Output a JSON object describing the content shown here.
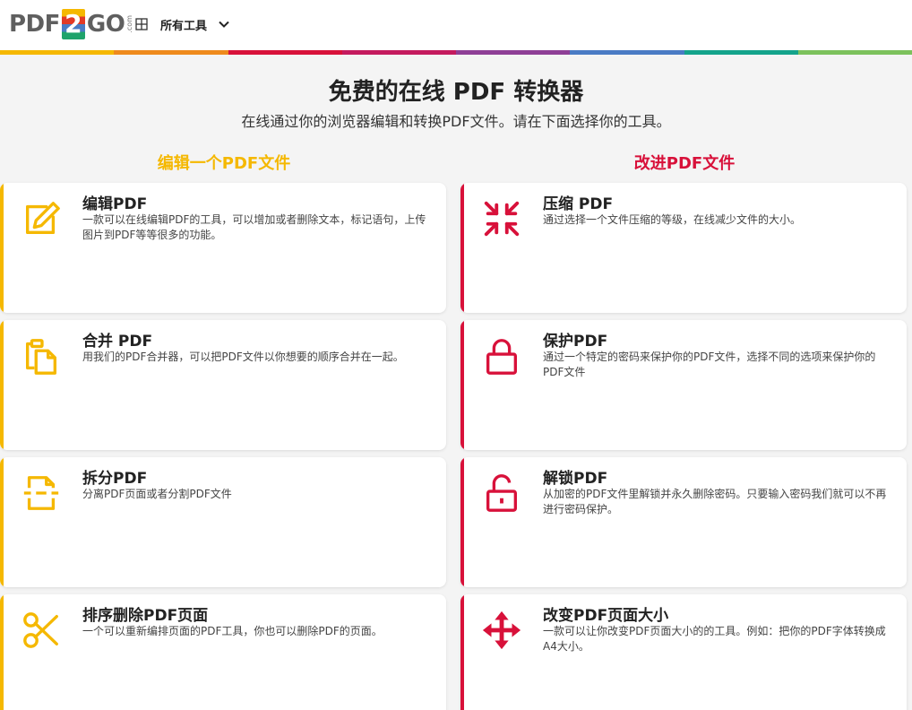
{
  "header": {
    "logo": {
      "pdf": "PDF",
      "two": "2",
      "go": "GO",
      "com": ".com"
    },
    "tools_menu_label": "所有工具"
  },
  "colors": {
    "yellow": "#f5b800",
    "red": "#d8113a",
    "stripe": [
      "#f5b800",
      "#ee8a1c",
      "#d8113a",
      "#c41a5e",
      "#8e3f96",
      "#4a7bc4",
      "#14a38b",
      "#7cc15c"
    ]
  },
  "hero": {
    "title": "免费的在线 PDF 转换器",
    "subtitle": "在线通过你的浏览器编辑和转换PDF文件。请在下面选择你的工具。"
  },
  "columns": {
    "left": {
      "heading": "编辑一个PDF文件",
      "cards": [
        {
          "icon": "edit-icon",
          "title": "编辑PDF",
          "desc": "一款可以在线编辑PDF的工具，可以增加或者删除文本，标记语句，上传图片到PDF等等很多的功能。"
        },
        {
          "icon": "merge-icon",
          "title": "合并 PDF",
          "desc": "用我们的PDF合并器，可以把PDF文件以你想要的顺序合并在一起。"
        },
        {
          "icon": "split-icon",
          "title": "拆分PDF",
          "desc": "分离PDF页面或者分割PDF文件"
        },
        {
          "icon": "scissors-icon",
          "title": "排序删除PDF页面",
          "desc": "一个可以重新编排页面的PDF工具，你也可以删除PDF的页面。"
        }
      ]
    },
    "right": {
      "heading": "改进PDF文件",
      "cards": [
        {
          "icon": "compress-icon",
          "title": "压缩 PDF",
          "desc": "通过选择一个文件压缩的等级，在线减少文件的大小。"
        },
        {
          "icon": "lock-icon",
          "title": "保护PDF",
          "desc": "通过一个特定的密码来保护你的PDF文件，选择不同的选项来保护你的PDF文件"
        },
        {
          "icon": "unlock-icon",
          "title": "解锁PDF",
          "desc": "从加密的PDF文件里解锁并永久删除密码。只要输入密码我们就可以不再进行密码保护。"
        },
        {
          "icon": "resize-icon",
          "title": "改变PDF页面大小",
          "desc": "一款可以让你改变PDF页面大小的的工具。例如：把你的PDF字体转换成A4大小。"
        }
      ]
    }
  }
}
